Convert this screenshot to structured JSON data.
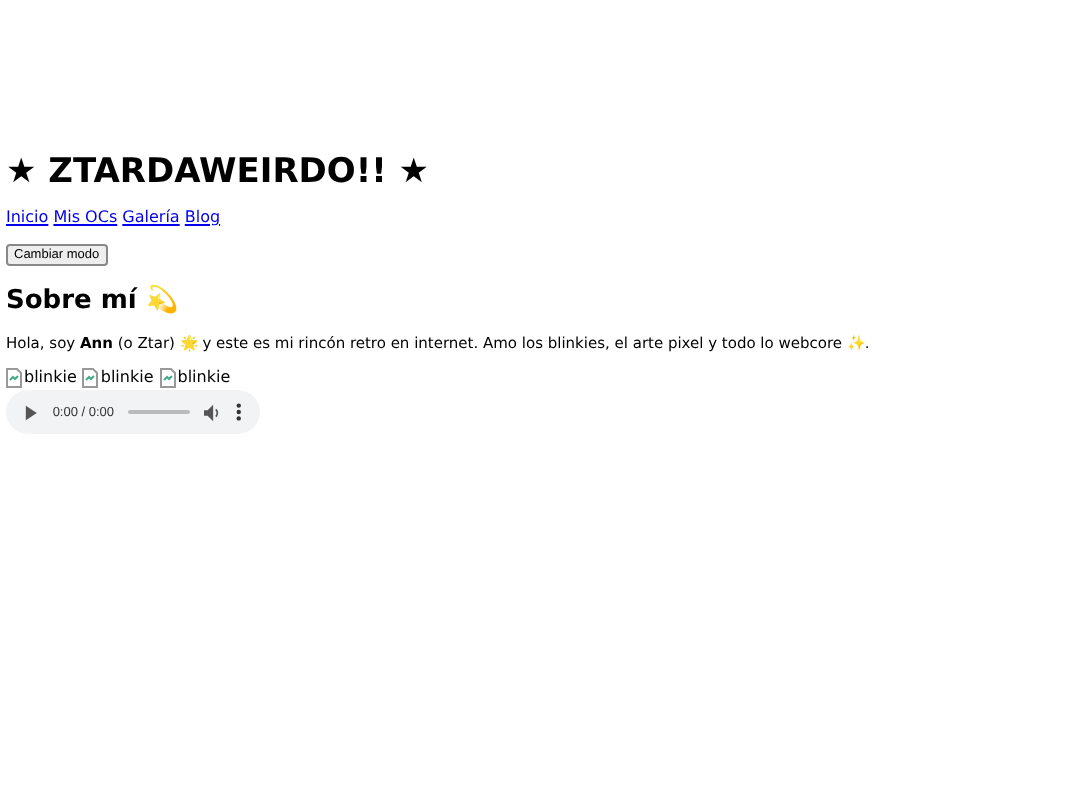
{
  "title": "★ ZTARDAWEIRDO!! ★",
  "nav": [
    "Inicio",
    "Mis OCs",
    "Galería",
    "Blog"
  ],
  "mode_button": "Cambiar modo",
  "section": {
    "heading": "Sobre mí 💫",
    "text": "Hola, soy **Ann** (o Ztar) 🌟 y este es mi rincón retro en internet. Amo los blinkies, el arte pixel y todo lo webcore ✨."
  },
  "blinkies": [
    "blinkie",
    "blinkie",
    "blinkie"
  ],
  "audio": {
    "time": "0:00 / 0:00"
  }
}
